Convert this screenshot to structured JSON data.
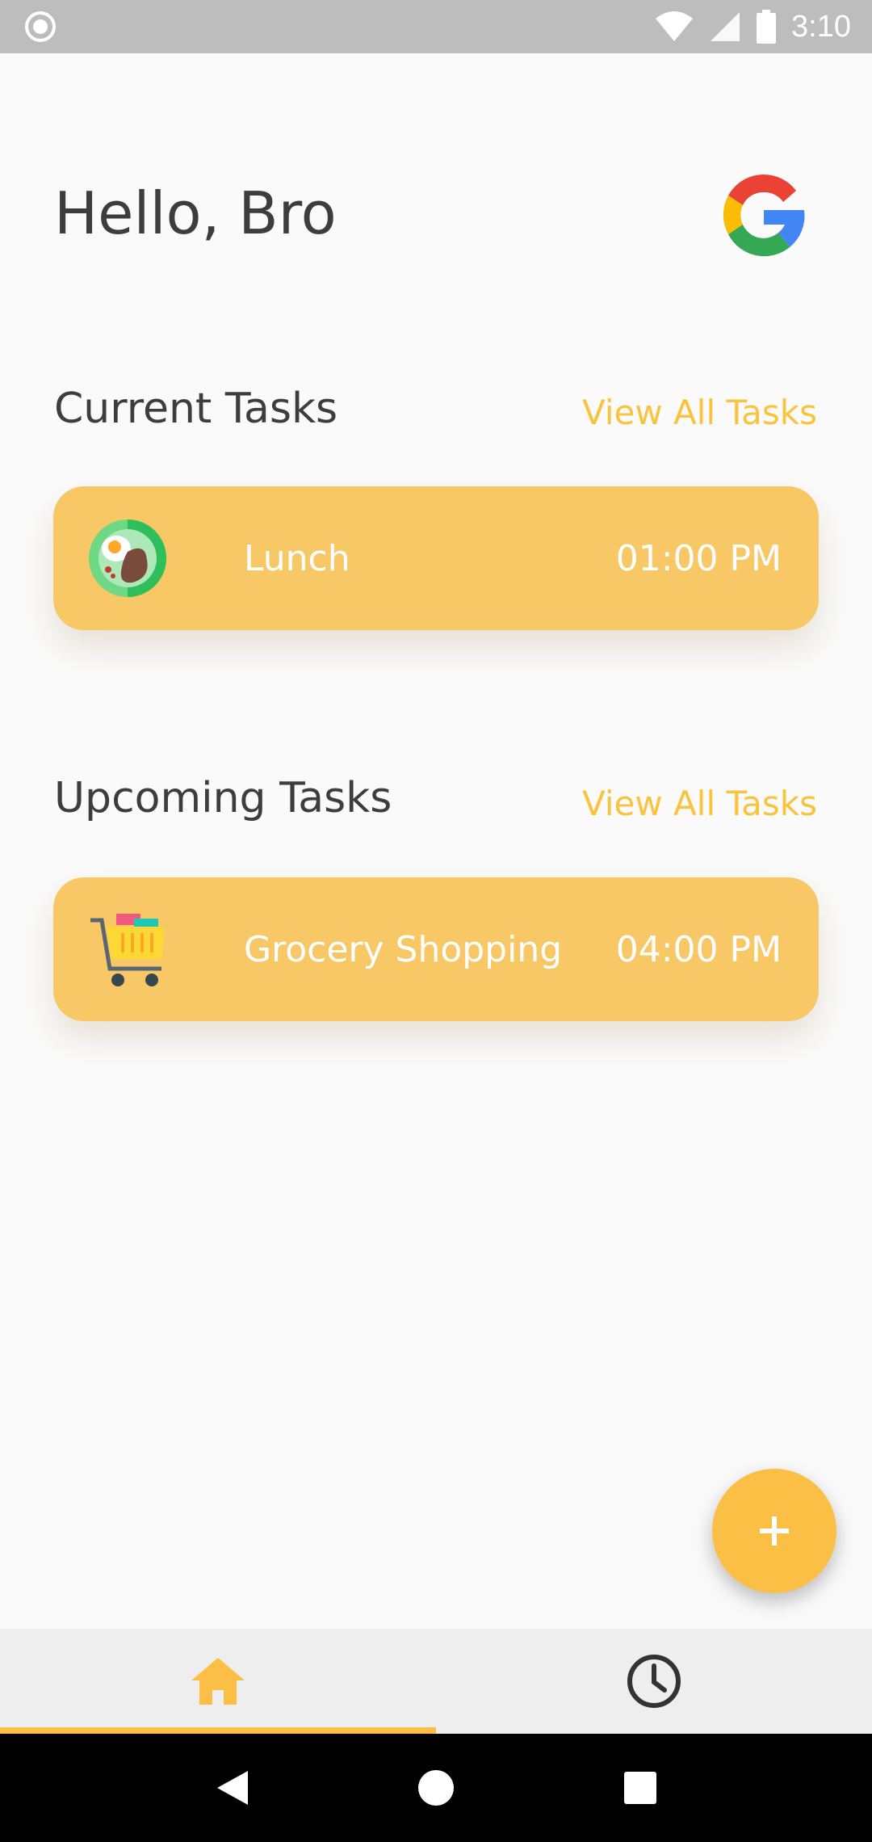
{
  "status_bar": {
    "time": "3:10",
    "icons": [
      "circle-notification-icon",
      "wifi-icon",
      "signal-icon",
      "battery-icon"
    ]
  },
  "header": {
    "greeting": "Hello, Bro",
    "logo": "google-logo"
  },
  "current_tasks": {
    "title": "Current Tasks",
    "view_all": "View All Tasks",
    "items": [
      {
        "icon": "lunch-plate-icon",
        "name": "Lunch",
        "time": "01:00 PM"
      }
    ]
  },
  "upcoming_tasks": {
    "title": "Upcoming Tasks",
    "view_all": "View All Tasks",
    "items": [
      {
        "icon": "shopping-cart-icon",
        "name": "Grocery Shopping",
        "time": "04:00 PM"
      }
    ]
  },
  "fab": {
    "icon": "plus-icon"
  },
  "bottom_nav": {
    "tabs": [
      {
        "icon": "home-icon",
        "active": true
      },
      {
        "icon": "clock-icon",
        "active": false
      }
    ]
  },
  "colors": {
    "accent": "#fbbf45",
    "card": "#f7c865",
    "link": "#f9c33d",
    "text": "#3d3d3d"
  }
}
